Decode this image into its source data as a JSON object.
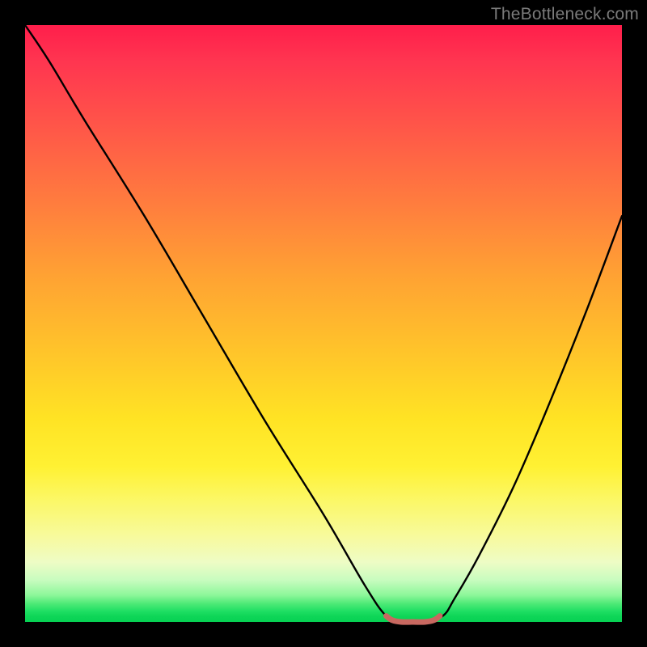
{
  "watermark": "TheBottleneck.com",
  "chart_data": {
    "type": "line",
    "title": "",
    "xlabel": "",
    "ylabel": "",
    "xlim": [
      0,
      100
    ],
    "ylim": [
      0,
      100
    ],
    "series": [
      {
        "name": "bottleneck-curve",
        "x": [
          0,
          4,
          10,
          20,
          30,
          40,
          50,
          57,
          60.5,
          63,
          67,
          70,
          72,
          76,
          82,
          88,
          94,
          100
        ],
        "values": [
          100,
          94,
          84,
          68,
          51,
          34,
          18,
          6,
          1,
          0,
          0,
          1,
          4,
          11,
          23,
          37,
          52,
          68
        ]
      },
      {
        "name": "optimal-marker",
        "x": [
          60.5,
          61.5,
          63,
          65,
          67,
          68.5,
          69.5
        ],
        "values": [
          1.0,
          0.3,
          0,
          0,
          0,
          0.3,
          1.0
        ]
      }
    ],
    "colors": {
      "curve": "#000000",
      "marker": "#c86860",
      "gradient_top": "#ff1e4b",
      "gradient_bottom": "#06d153"
    }
  }
}
